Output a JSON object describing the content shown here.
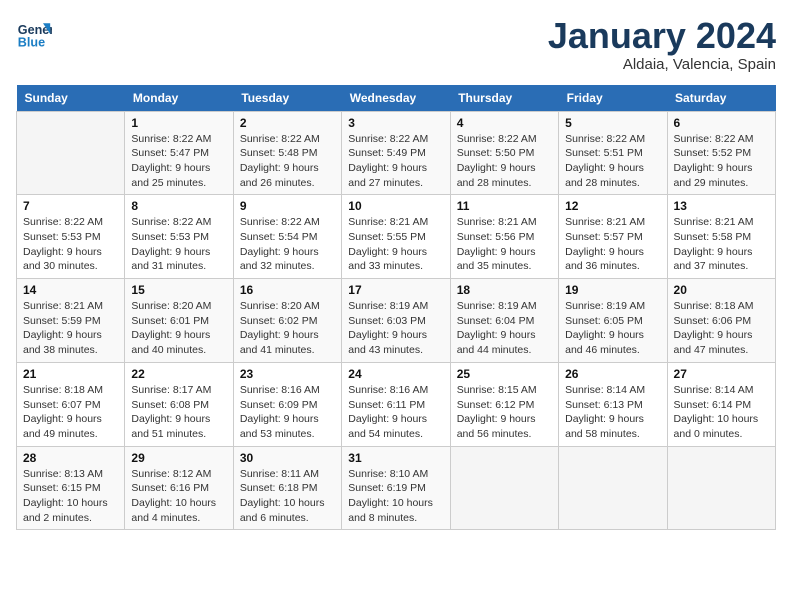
{
  "header": {
    "logo_line1": "General",
    "logo_line2": "Blue",
    "month_title": "January 2024",
    "location": "Aldaia, Valencia, Spain"
  },
  "weekdays": [
    "Sunday",
    "Monday",
    "Tuesday",
    "Wednesday",
    "Thursday",
    "Friday",
    "Saturday"
  ],
  "weeks": [
    [
      {
        "day": "",
        "info": ""
      },
      {
        "day": "1",
        "info": "Sunrise: 8:22 AM\nSunset: 5:47 PM\nDaylight: 9 hours\nand 25 minutes."
      },
      {
        "day": "2",
        "info": "Sunrise: 8:22 AM\nSunset: 5:48 PM\nDaylight: 9 hours\nand 26 minutes."
      },
      {
        "day": "3",
        "info": "Sunrise: 8:22 AM\nSunset: 5:49 PM\nDaylight: 9 hours\nand 27 minutes."
      },
      {
        "day": "4",
        "info": "Sunrise: 8:22 AM\nSunset: 5:50 PM\nDaylight: 9 hours\nand 28 minutes."
      },
      {
        "day": "5",
        "info": "Sunrise: 8:22 AM\nSunset: 5:51 PM\nDaylight: 9 hours\nand 28 minutes."
      },
      {
        "day": "6",
        "info": "Sunrise: 8:22 AM\nSunset: 5:52 PM\nDaylight: 9 hours\nand 29 minutes."
      }
    ],
    [
      {
        "day": "7",
        "info": "Sunrise: 8:22 AM\nSunset: 5:53 PM\nDaylight: 9 hours\nand 30 minutes."
      },
      {
        "day": "8",
        "info": "Sunrise: 8:22 AM\nSunset: 5:53 PM\nDaylight: 9 hours\nand 31 minutes."
      },
      {
        "day": "9",
        "info": "Sunrise: 8:22 AM\nSunset: 5:54 PM\nDaylight: 9 hours\nand 32 minutes."
      },
      {
        "day": "10",
        "info": "Sunrise: 8:21 AM\nSunset: 5:55 PM\nDaylight: 9 hours\nand 33 minutes."
      },
      {
        "day": "11",
        "info": "Sunrise: 8:21 AM\nSunset: 5:56 PM\nDaylight: 9 hours\nand 35 minutes."
      },
      {
        "day": "12",
        "info": "Sunrise: 8:21 AM\nSunset: 5:57 PM\nDaylight: 9 hours\nand 36 minutes."
      },
      {
        "day": "13",
        "info": "Sunrise: 8:21 AM\nSunset: 5:58 PM\nDaylight: 9 hours\nand 37 minutes."
      }
    ],
    [
      {
        "day": "14",
        "info": "Sunrise: 8:21 AM\nSunset: 5:59 PM\nDaylight: 9 hours\nand 38 minutes."
      },
      {
        "day": "15",
        "info": "Sunrise: 8:20 AM\nSunset: 6:01 PM\nDaylight: 9 hours\nand 40 minutes."
      },
      {
        "day": "16",
        "info": "Sunrise: 8:20 AM\nSunset: 6:02 PM\nDaylight: 9 hours\nand 41 minutes."
      },
      {
        "day": "17",
        "info": "Sunrise: 8:19 AM\nSunset: 6:03 PM\nDaylight: 9 hours\nand 43 minutes."
      },
      {
        "day": "18",
        "info": "Sunrise: 8:19 AM\nSunset: 6:04 PM\nDaylight: 9 hours\nand 44 minutes."
      },
      {
        "day": "19",
        "info": "Sunrise: 8:19 AM\nSunset: 6:05 PM\nDaylight: 9 hours\nand 46 minutes."
      },
      {
        "day": "20",
        "info": "Sunrise: 8:18 AM\nSunset: 6:06 PM\nDaylight: 9 hours\nand 47 minutes."
      }
    ],
    [
      {
        "day": "21",
        "info": "Sunrise: 8:18 AM\nSunset: 6:07 PM\nDaylight: 9 hours\nand 49 minutes."
      },
      {
        "day": "22",
        "info": "Sunrise: 8:17 AM\nSunset: 6:08 PM\nDaylight: 9 hours\nand 51 minutes."
      },
      {
        "day": "23",
        "info": "Sunrise: 8:16 AM\nSunset: 6:09 PM\nDaylight: 9 hours\nand 53 minutes."
      },
      {
        "day": "24",
        "info": "Sunrise: 8:16 AM\nSunset: 6:11 PM\nDaylight: 9 hours\nand 54 minutes."
      },
      {
        "day": "25",
        "info": "Sunrise: 8:15 AM\nSunset: 6:12 PM\nDaylight: 9 hours\nand 56 minutes."
      },
      {
        "day": "26",
        "info": "Sunrise: 8:14 AM\nSunset: 6:13 PM\nDaylight: 9 hours\nand 58 minutes."
      },
      {
        "day": "27",
        "info": "Sunrise: 8:14 AM\nSunset: 6:14 PM\nDaylight: 10 hours\nand 0 minutes."
      }
    ],
    [
      {
        "day": "28",
        "info": "Sunrise: 8:13 AM\nSunset: 6:15 PM\nDaylight: 10 hours\nand 2 minutes."
      },
      {
        "day": "29",
        "info": "Sunrise: 8:12 AM\nSunset: 6:16 PM\nDaylight: 10 hours\nand 4 minutes."
      },
      {
        "day": "30",
        "info": "Sunrise: 8:11 AM\nSunset: 6:18 PM\nDaylight: 10 hours\nand 6 minutes."
      },
      {
        "day": "31",
        "info": "Sunrise: 8:10 AM\nSunset: 6:19 PM\nDaylight: 10 hours\nand 8 minutes."
      },
      {
        "day": "",
        "info": ""
      },
      {
        "day": "",
        "info": ""
      },
      {
        "day": "",
        "info": ""
      }
    ]
  ]
}
